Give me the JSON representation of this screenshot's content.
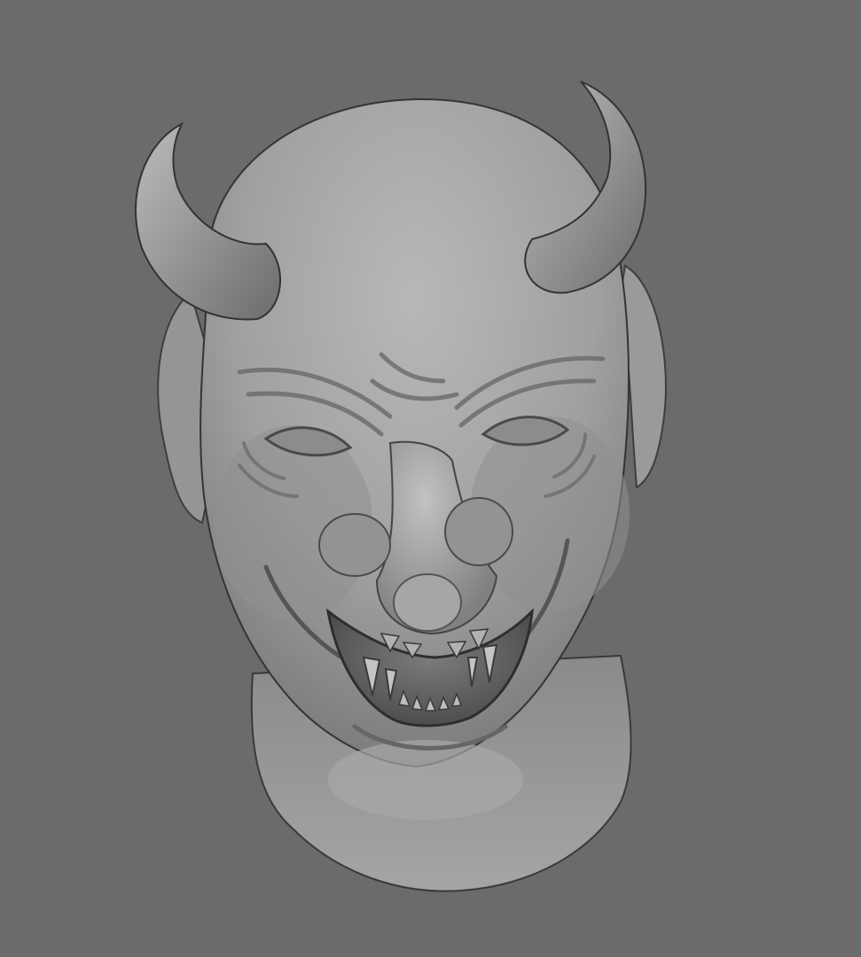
{
  "viewport": {
    "background_color": "#6b6b6b",
    "shading": "matcap-grey",
    "model_color": "#9a9a9a"
  },
  "model": {
    "subject": "demon-head-sculpt",
    "features": [
      "horns",
      "pointed-ears",
      "wrinkled-brow",
      "grinning-mouth",
      "fangs",
      "neck"
    ]
  }
}
